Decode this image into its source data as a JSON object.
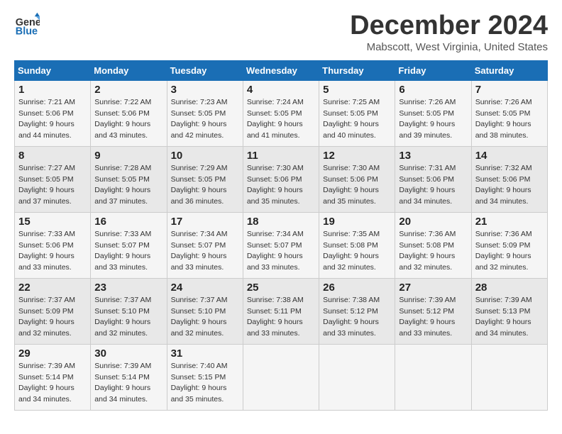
{
  "logo": {
    "text_general": "General",
    "text_blue": "Blue"
  },
  "title": "December 2024",
  "subtitle": "Mabscott, West Virginia, United States",
  "days_of_week": [
    "Sunday",
    "Monday",
    "Tuesday",
    "Wednesday",
    "Thursday",
    "Friday",
    "Saturday"
  ],
  "weeks": [
    [
      {
        "day": 1,
        "rise": "7:21 AM",
        "set": "5:06 PM",
        "hours": "9",
        "mins": "44"
      },
      {
        "day": 2,
        "rise": "7:22 AM",
        "set": "5:06 PM",
        "hours": "9",
        "mins": "43"
      },
      {
        "day": 3,
        "rise": "7:23 AM",
        "set": "5:05 PM",
        "hours": "9",
        "mins": "42"
      },
      {
        "day": 4,
        "rise": "7:24 AM",
        "set": "5:05 PM",
        "hours": "9",
        "mins": "41"
      },
      {
        "day": 5,
        "rise": "7:25 AM",
        "set": "5:05 PM",
        "hours": "9",
        "mins": "40"
      },
      {
        "day": 6,
        "rise": "7:26 AM",
        "set": "5:05 PM",
        "hours": "9",
        "mins": "39"
      },
      {
        "day": 7,
        "rise": "7:26 AM",
        "set": "5:05 PM",
        "hours": "9",
        "mins": "38"
      }
    ],
    [
      {
        "day": 8,
        "rise": "7:27 AM",
        "set": "5:05 PM",
        "hours": "9",
        "mins": "37"
      },
      {
        "day": 9,
        "rise": "7:28 AM",
        "set": "5:05 PM",
        "hours": "9",
        "mins": "37"
      },
      {
        "day": 10,
        "rise": "7:29 AM",
        "set": "5:05 PM",
        "hours": "9",
        "mins": "36"
      },
      {
        "day": 11,
        "rise": "7:30 AM",
        "set": "5:06 PM",
        "hours": "9",
        "mins": "35"
      },
      {
        "day": 12,
        "rise": "7:30 AM",
        "set": "5:06 PM",
        "hours": "9",
        "mins": "35"
      },
      {
        "day": 13,
        "rise": "7:31 AM",
        "set": "5:06 PM",
        "hours": "9",
        "mins": "34"
      },
      {
        "day": 14,
        "rise": "7:32 AM",
        "set": "5:06 PM",
        "hours": "9",
        "mins": "34"
      }
    ],
    [
      {
        "day": 15,
        "rise": "7:33 AM",
        "set": "5:06 PM",
        "hours": "9",
        "mins": "33"
      },
      {
        "day": 16,
        "rise": "7:33 AM",
        "set": "5:07 PM",
        "hours": "9",
        "mins": "33"
      },
      {
        "day": 17,
        "rise": "7:34 AM",
        "set": "5:07 PM",
        "hours": "9",
        "mins": "33"
      },
      {
        "day": 18,
        "rise": "7:34 AM",
        "set": "5:07 PM",
        "hours": "9",
        "mins": "33"
      },
      {
        "day": 19,
        "rise": "7:35 AM",
        "set": "5:08 PM",
        "hours": "9",
        "mins": "32"
      },
      {
        "day": 20,
        "rise": "7:36 AM",
        "set": "5:08 PM",
        "hours": "9",
        "mins": "32"
      },
      {
        "day": 21,
        "rise": "7:36 AM",
        "set": "5:09 PM",
        "hours": "9",
        "mins": "32"
      }
    ],
    [
      {
        "day": 22,
        "rise": "7:37 AM",
        "set": "5:09 PM",
        "hours": "9",
        "mins": "32"
      },
      {
        "day": 23,
        "rise": "7:37 AM",
        "set": "5:10 PM",
        "hours": "9",
        "mins": "32"
      },
      {
        "day": 24,
        "rise": "7:37 AM",
        "set": "5:10 PM",
        "hours": "9",
        "mins": "32"
      },
      {
        "day": 25,
        "rise": "7:38 AM",
        "set": "5:11 PM",
        "hours": "9",
        "mins": "33"
      },
      {
        "day": 26,
        "rise": "7:38 AM",
        "set": "5:12 PM",
        "hours": "9",
        "mins": "33"
      },
      {
        "day": 27,
        "rise": "7:39 AM",
        "set": "5:12 PM",
        "hours": "9",
        "mins": "33"
      },
      {
        "day": 28,
        "rise": "7:39 AM",
        "set": "5:13 PM",
        "hours": "9",
        "mins": "34"
      }
    ],
    [
      {
        "day": 29,
        "rise": "7:39 AM",
        "set": "5:14 PM",
        "hours": "9",
        "mins": "34"
      },
      {
        "day": 30,
        "rise": "7:39 AM",
        "set": "5:14 PM",
        "hours": "9",
        "mins": "34"
      },
      {
        "day": 31,
        "rise": "7:40 AM",
        "set": "5:15 PM",
        "hours": "9",
        "mins": "35"
      },
      null,
      null,
      null,
      null
    ]
  ]
}
